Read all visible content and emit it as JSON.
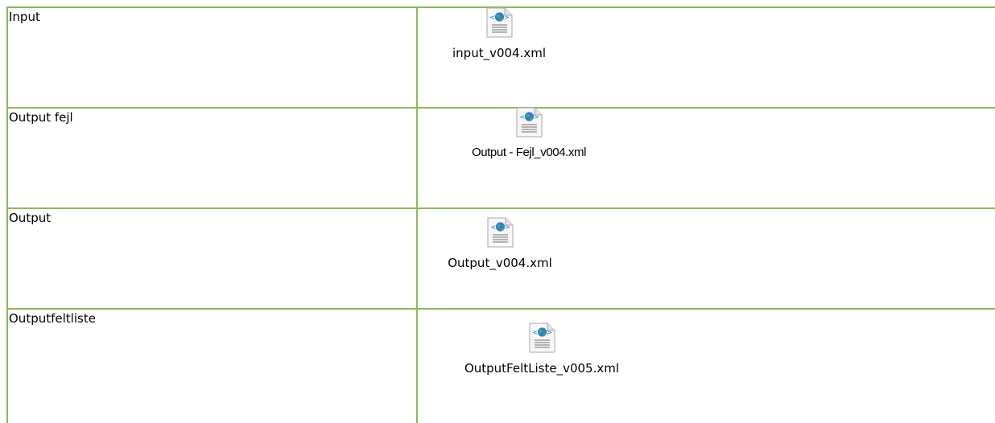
{
  "rows": [
    {
      "label": "Input",
      "file": {
        "name": "input_v004.xml",
        "icon": "xml-file-icon"
      }
    },
    {
      "label": "Output fejl",
      "file": {
        "name": "Output - Fejl_v004.xml",
        "icon": "xml-file-icon"
      }
    },
    {
      "label": "Output",
      "file": {
        "name": "Output_v004.xml",
        "icon": "xml-file-icon"
      }
    },
    {
      "label": "Outputfeltliste",
      "file": {
        "name": "OutputFeltListe_v005.xml",
        "icon": "xml-file-icon"
      }
    }
  ],
  "colors": {
    "border": "#8db85e",
    "text": "#000000",
    "background": "#ffffff"
  }
}
